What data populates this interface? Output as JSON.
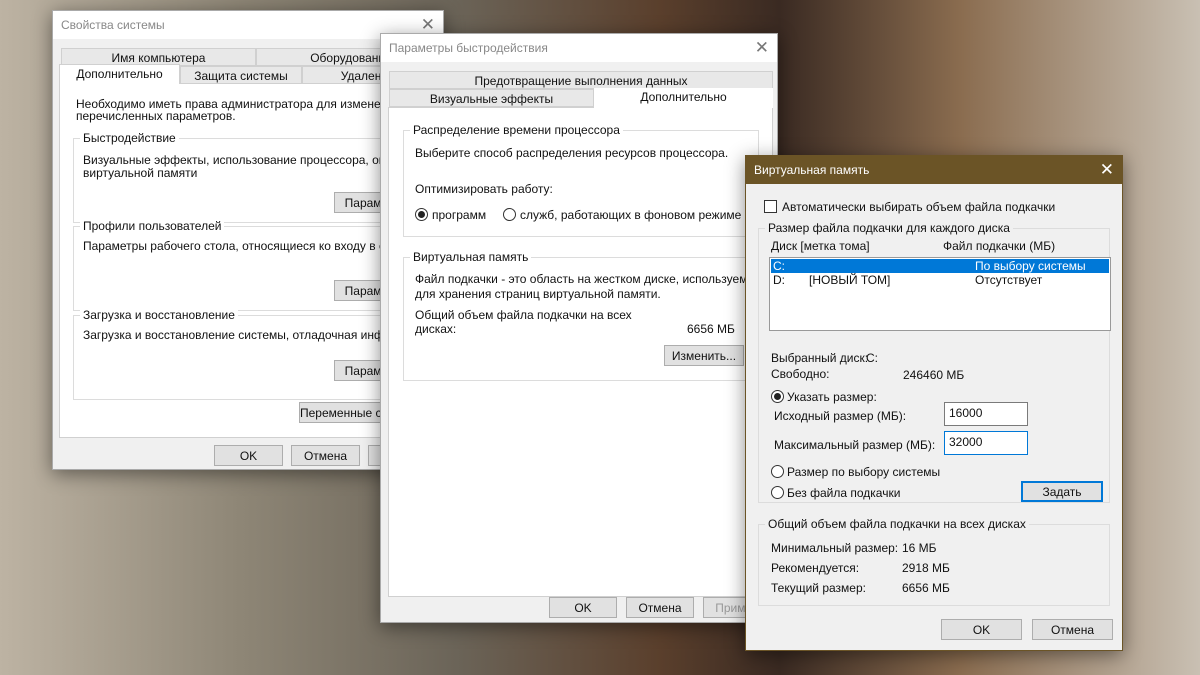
{
  "system_props": {
    "title": "Свойства системы",
    "tabs_row1": [
      "Имя компьютера",
      "Оборудование"
    ],
    "tabs_row2": [
      "Дополнительно",
      "Защита системы",
      "Удаленный"
    ],
    "admin_note": "Необходимо иметь права администратора для изменения бол",
    "admin_note2": "перечисленных параметров.",
    "groups": [
      {
        "legend": "Быстродействие",
        "text": "Визуальные эффекты, использование процессора, оператив",
        "text2": "виртуальной памяти",
        "button": "Парамет"
      },
      {
        "legend": "Профили пользователей",
        "text": "Параметры рабочего стола, относящиеся ко входу в систему",
        "text2": "",
        "button": "Парамет"
      },
      {
        "legend": "Загрузка и восстановление",
        "text": "Загрузка и восстановление системы, отладочная информаци",
        "text2": "",
        "button": "Парамет"
      }
    ],
    "env_button": "Переменные ср",
    "ok": "OK",
    "cancel": "Отмена",
    "apply": "П"
  },
  "perf": {
    "title": "Параметры быстродействия",
    "tab_top": "Предотвращение выполнения данных",
    "tab_visual": "Визуальные эффекты",
    "tab_advanced": "Дополнительно",
    "cpu_legend": "Распределение времени процессора",
    "cpu_text": "Выберите способ распределения ресурсов процессора.",
    "optimize": "Оптимизировать работу:",
    "opt_programs": "программ",
    "opt_services": "служб, работающих в фоновом режиме",
    "vm_legend": "Виртуальная память",
    "vm_text": "Файл подкачки - это область на жестком диске, используемая",
    "vm_text2": "для хранения страниц виртуальной памяти.",
    "vm_total_label": "Общий объем файла подкачки на всех",
    "vm_total_label2": "дисках:",
    "vm_total": "6656 МБ",
    "change": "Изменить...",
    "ok": "OK",
    "cancel": "Отмена",
    "apply": "Примен"
  },
  "vm": {
    "title": "Виртуальная память",
    "auto": "Автоматически выбирать объем файла подкачки",
    "auto_checked": false,
    "size_legend": "Размер файла подкачки для каждого диска",
    "col_disk": "Диск [метка тома]",
    "col_file": "Файл подкачки (МБ)",
    "drives": [
      {
        "disk": "C:",
        "label": "",
        "file": "По выбору системы"
      },
      {
        "disk": "D:",
        "label": "[НОВЫЙ ТОМ]",
        "file": "Отсутствует"
      }
    ],
    "selected_label": "Выбранный диск:",
    "selected": "C:",
    "free_label": "Свободно:",
    "free": "246460 МБ",
    "custom": "Указать размер:",
    "initial_label": "Исходный размер (МБ):",
    "initial": "16000",
    "max_label": "Максимальный размер (МБ):",
    "max": "32000",
    "system_size": "Размер по выбору системы",
    "no_file": "Без файла подкачки",
    "set": "Задать",
    "total_legend": "Общий объем файла подкачки на всех дисках",
    "min_label": "Минимальный размер:",
    "min": "16 МБ",
    "rec_label": "Рекомендуется:",
    "rec": "2918 МБ",
    "cur_label": "Текущий размер:",
    "cur": "6656 МБ",
    "ok": "OK",
    "cancel": "Отмена",
    "accent": "#6b5426"
  }
}
